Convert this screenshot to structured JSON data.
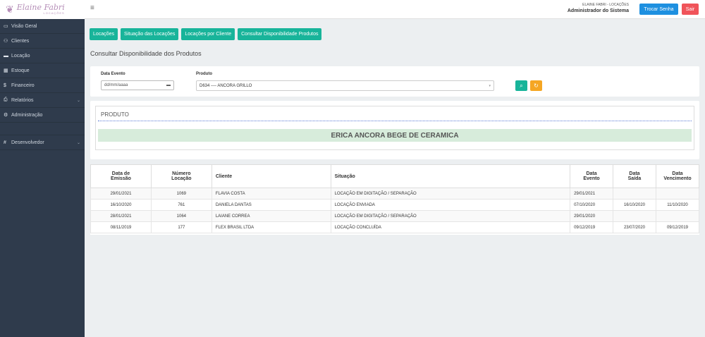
{
  "logo": {
    "name": "Elaine Fabri",
    "sub": "LOCAÇÕES"
  },
  "header": {
    "company": "ELAINE FABRI - LOCAÇÕES",
    "role": "Administrador do Sistema",
    "btn_senha": "Trocar Senha",
    "btn_sair": "Sair"
  },
  "sidebar": {
    "items": [
      {
        "icon": "▭",
        "label": "Visão Geral"
      },
      {
        "icon": "⚇",
        "label": "Clientes"
      },
      {
        "icon": "▬",
        "label": "Locação"
      },
      {
        "icon": "▦",
        "label": "Estoque"
      },
      {
        "icon": "$",
        "label": "Financeiro"
      },
      {
        "icon": "⎙",
        "label": "Relatórios",
        "chev": "⌄"
      },
      {
        "icon": "⚙",
        "label": "Administração"
      },
      {
        "icon": "#",
        "label": "Desenvolvedor",
        "chev": "⌄"
      }
    ]
  },
  "nav": [
    "Locações",
    "Situação das Locações",
    "Locações por Cliente",
    "Consultar Disponibilidade Produtos"
  ],
  "page_title": "Consultar Disponibilidade dos Produtos",
  "filter": {
    "date_label": "Data Evento",
    "date_placeholder": "dd/mm/aaaa",
    "product_label": "Produto",
    "product_value": "D634 ---- ANCORA GRILLO"
  },
  "product": {
    "label": "PRODUTO",
    "name": "ERICA ANCORA BEGE DE CERAMICA"
  },
  "table": {
    "headers": [
      {
        "l1": "Data de",
        "l2": "Emissão"
      },
      {
        "l1": "Número",
        "l2": "Locação"
      },
      {
        "l1": "Cliente",
        "l2": ""
      },
      {
        "l1": "Situação",
        "l2": ""
      },
      {
        "l1": "Data",
        "l2": "Evento"
      },
      {
        "l1": "Data",
        "l2": "Saída"
      },
      {
        "l1": "Data",
        "l2": "Vencimento"
      }
    ],
    "rows": [
      [
        "29/01/2021",
        "1069",
        "FLAVIA COSTA",
        "LOCAÇÃO EM DIGITAÇÃO / SEPARAÇÃO",
        "29/01/2021",
        "",
        ""
      ],
      [
        "16/10/2020",
        "761",
        "DANIELA DANTAS",
        "LOCAÇÃO ENVIADA",
        "07/10/2020",
        "16/10/2020",
        "11/10/2020"
      ],
      [
        "28/01/2021",
        "1064",
        "LAIANE CORREA",
        "LOCAÇÃO EM DIGITAÇÃO / SEPARAÇÃO",
        "29/01/2020",
        "",
        ""
      ],
      [
        "08/11/2019",
        "177",
        "FLEX BRASIL LTDA",
        "LOCAÇÃO CONCLUÍDA",
        "09/12/2019",
        "23/07/2020",
        "09/12/2019"
      ]
    ]
  }
}
